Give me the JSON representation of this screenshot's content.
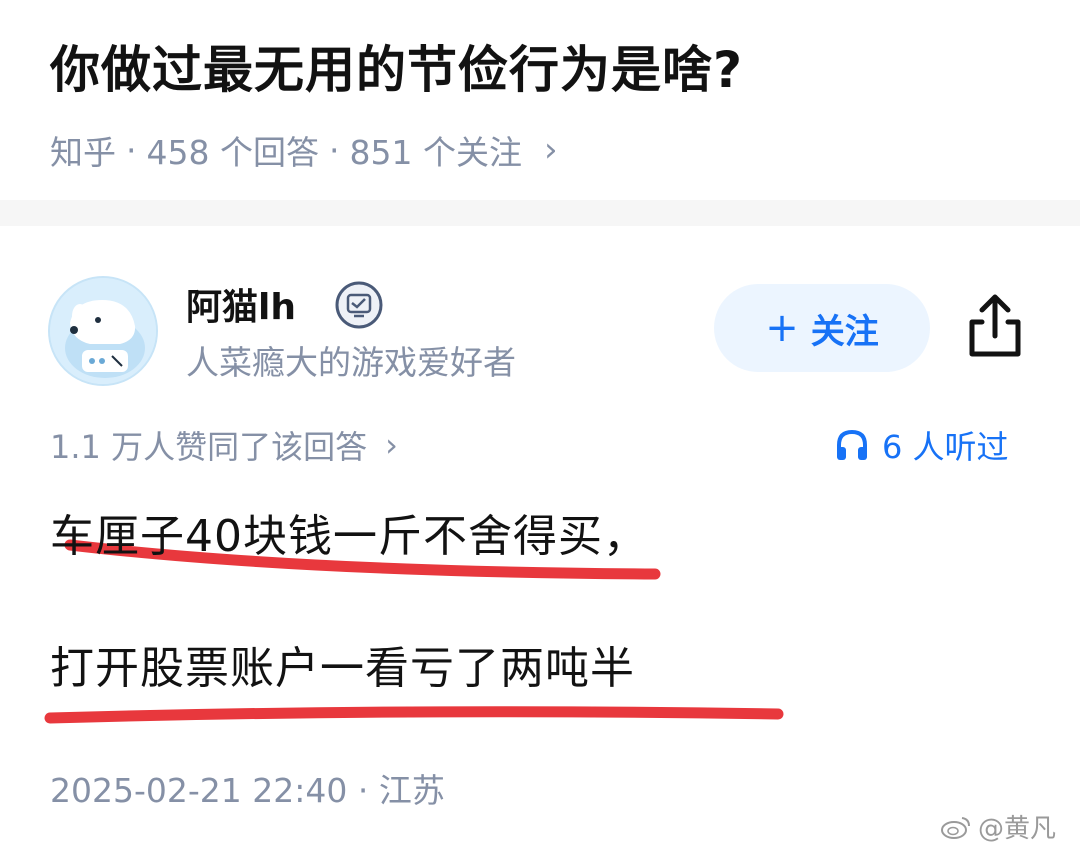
{
  "question": {
    "title": "你做过最无用的节俭行为是啥?",
    "meta": {
      "source": "知乎",
      "answers": "458 个回答",
      "followers": "851 个关注"
    }
  },
  "answer": {
    "author": {
      "name": "阿猫lh",
      "bio": "人菜瘾大的游戏爱好者"
    },
    "follow_label": "关注",
    "votes_text": "1.1 万人赞同了该回答",
    "listeners_text": "6 人听过",
    "content": {
      "line1": "车厘子40块钱一斤不舍得买，",
      "line2": "打开股票账户一看亏了两吨半"
    },
    "date_location": "2025-02-21 22:40 · 江苏"
  },
  "watermark": "@黄凡",
  "colors": {
    "accent": "#1772f6",
    "follow_bg": "#ecf5ff",
    "meta_gray": "#8590a6",
    "underline_red": "#e8383d"
  },
  "icons": [
    "chevron-right-icon",
    "verified-badge-icon",
    "share-icon",
    "headphones-icon",
    "weibo-icon"
  ]
}
